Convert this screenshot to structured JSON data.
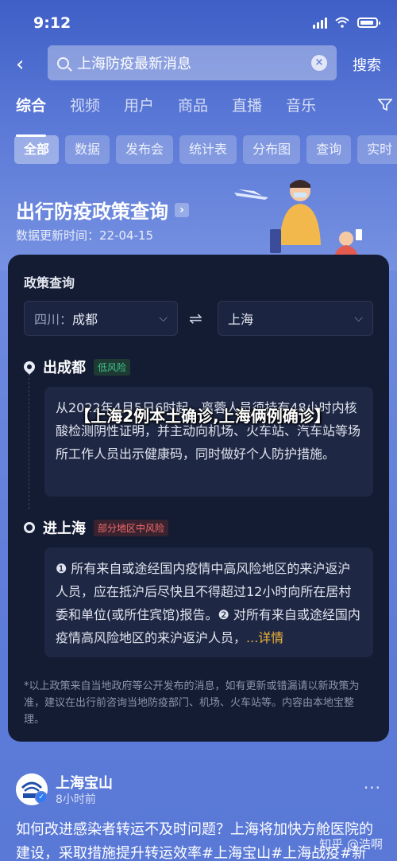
{
  "status_bar": {
    "time": "9:12"
  },
  "search": {
    "back_glyph": "‹",
    "query": "上海防疫最新消息",
    "clear_glyph": "×",
    "submit_label": "搜索"
  },
  "tabs": [
    {
      "label": "综合"
    },
    {
      "label": "视频"
    },
    {
      "label": "用户"
    },
    {
      "label": "商品"
    },
    {
      "label": "直播"
    },
    {
      "label": "音乐"
    }
  ],
  "chips": [
    {
      "label": "全部"
    },
    {
      "label": "数据"
    },
    {
      "label": "发布会"
    },
    {
      "label": "统计表"
    },
    {
      "label": "分布图"
    },
    {
      "label": "查询"
    },
    {
      "label": "实时"
    }
  ],
  "policy": {
    "title": "出行防疫政策查询",
    "arrow": "›",
    "updated": "数据更新时间：22-04-15"
  },
  "card": {
    "title": "政策查询",
    "from": {
      "prefix": "四川：",
      "city": "成都"
    },
    "swap_glyph": "⇌",
    "to": {
      "city": "上海"
    },
    "chevron": "⌵",
    "depart": {
      "place": "出成都",
      "tag": "低风险",
      "text": "从2022年4月5日6时起，离蓉人员须持有48小时内核酸检测阴性证明，并主动向机场、火车站、汽车站等场所工作人员出示健康码，同时做好个人防护措施。"
    },
    "arrive": {
      "place": "进上海",
      "tag": "部分地区中风险",
      "text": "❶ 所有来自或途经国内疫情中高风险地区的来沪返沪人员，应在抵沪后尽快且不得超过12小时向所在居村委和单位(或所住宾馆)报告。❷ 对所有来自或途经国内疫情高风险地区的来沪返沪人员，",
      "more": "...详情"
    },
    "disclaimer": "*以上政策来自当地政府等公开发布的消息，如有更新或错漏请以新政策为准，建议在出行前咨询当地防疫部门、机场、火车站等。内容由本地宝整理。"
  },
  "overlay": {
    "caption": "【上海2例本土确诊,上海俩例确诊】"
  },
  "post": {
    "author": "上海宝山",
    "verify_glyph": "✓",
    "avatar_text": "上海宝山",
    "time": "8小时前",
    "more": "···",
    "text": "如何改进感染者转运不及时问题？上海将加快方舱医院的建设，采取措施提升转运效率#上海宝山#上海战疫#新",
    "watermark": "知乎 @浩啊"
  },
  "colors": {
    "background": "#5d7bd8",
    "card": "#141c33",
    "accent_more": "#f0b43a",
    "low_risk": "#3ec48a",
    "mid_risk": "#f36a6a"
  }
}
